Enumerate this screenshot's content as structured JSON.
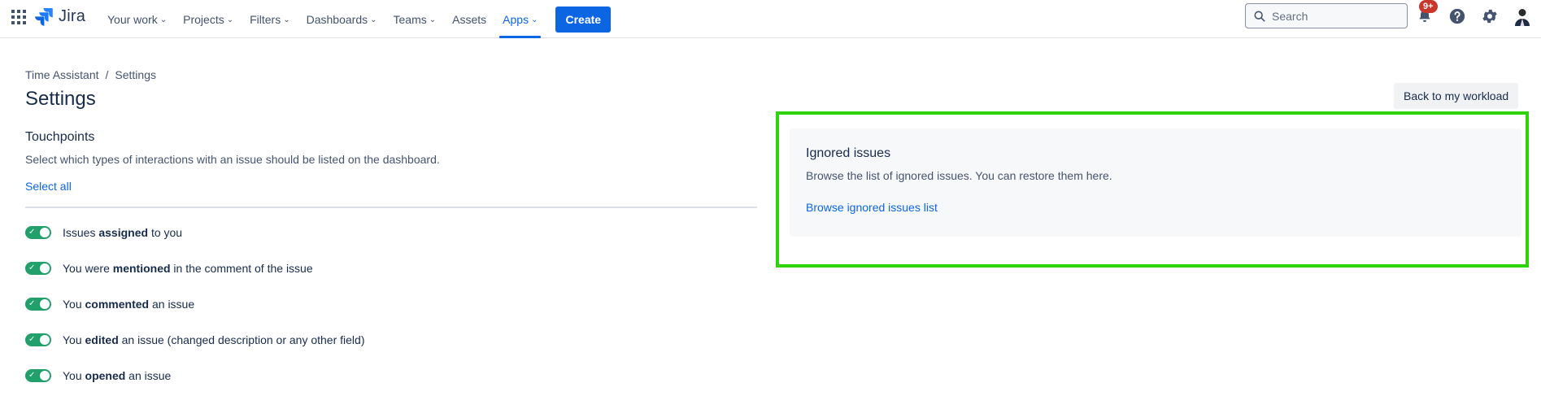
{
  "nav": {
    "logo_text": "Jira",
    "items": [
      {
        "label": "Your work",
        "chevron": true
      },
      {
        "label": "Projects",
        "chevron": true
      },
      {
        "label": "Filters",
        "chevron": true
      },
      {
        "label": "Dashboards",
        "chevron": true
      },
      {
        "label": "Teams",
        "chevron": true
      },
      {
        "label": "Assets",
        "chevron": false
      },
      {
        "label": "Apps",
        "chevron": true
      }
    ],
    "active_item": "Apps",
    "create_label": "Create",
    "search_placeholder": "Search",
    "notifications_badge": "9+",
    "icons": [
      "app-switcher-icon",
      "jira-logo-icon",
      "search-icon",
      "bell-icon",
      "help-icon",
      "gear-icon",
      "avatar"
    ]
  },
  "breadcrumb": {
    "items": [
      "Time Assistant",
      "Settings"
    ],
    "separator": "/"
  },
  "page": {
    "title": "Settings",
    "back_button": "Back to my workload"
  },
  "touchpoints": {
    "title": "Touchpoints",
    "description": "Select which types of interactions with an issue should be listed on the dashboard.",
    "select_all": "Select all",
    "options": [
      {
        "pre": "Issues ",
        "bold": "assigned",
        "post": " to you",
        "enabled": true
      },
      {
        "pre": "You were ",
        "bold": "mentioned",
        "post": " in the comment of the issue",
        "enabled": true
      },
      {
        "pre": "You ",
        "bold": "commented",
        "post": " an issue",
        "enabled": true
      },
      {
        "pre": "You ",
        "bold": "edited",
        "post": " an issue (changed description or any other field)",
        "enabled": true
      },
      {
        "pre": "You ",
        "bold": "opened",
        "post": " an issue",
        "enabled": true
      }
    ]
  },
  "ignored": {
    "title": "Ignored issues",
    "description": "Browse the list of ignored issues. You can restore them here.",
    "link": "Browse ignored issues list"
  },
  "colors": {
    "accent": "#0c66e4",
    "toggle_on": "#22a06b",
    "highlight": "#2ed30a",
    "badge": "#c9372c"
  }
}
